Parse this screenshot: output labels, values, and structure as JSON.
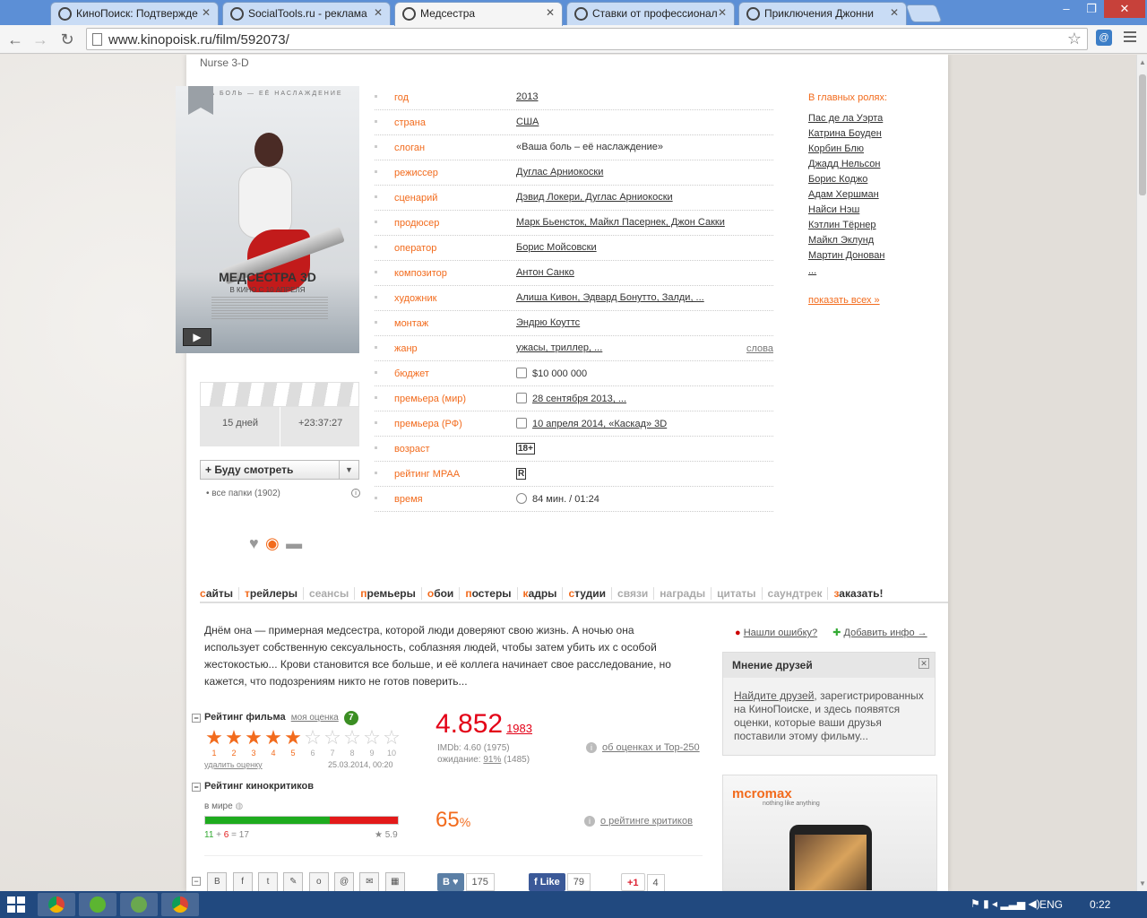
{
  "browser": {
    "tabs": [
      {
        "title": "КиноПоиск: Подтвержде",
        "active": false
      },
      {
        "title": "SocialTools.ru - реклама",
        "active": false
      },
      {
        "title": "Медсестра",
        "active": true
      },
      {
        "title": "Ставки от профессионал",
        "active": false
      },
      {
        "title": "Приключения Джонни",
        "active": false
      }
    ],
    "url": "www.kinopoisk.ru/film/592073/"
  },
  "film": {
    "original_title": "Nurse 3-D",
    "poster": {
      "slogan": "ША БОЛЬ — ЕЁ НАСЛАЖДЕНИЕ",
      "title": "МЕДСЕСТРА 3D",
      "date": "В КИНО С 10 АПРЕЛЯ"
    },
    "countdown": {
      "days": "15 дней",
      "time": "+23:37:27"
    },
    "watch_button": "+ Буду смотреть",
    "folders": "• все папки (1902)",
    "info": [
      {
        "label": "год",
        "value": "2013"
      },
      {
        "label": "страна",
        "value": "США"
      },
      {
        "label": "слоган",
        "value": "«Ваша боль – её наслаждение»"
      },
      {
        "label": "режиссер",
        "value": "Дуглас Арниокоски"
      },
      {
        "label": "сценарий",
        "value": "Дэвид Локери, Дуглас Арниокоски"
      },
      {
        "label": "продюсер",
        "value": "Марк Бьенсток, Майкл Пасернек, Джон Сакки"
      },
      {
        "label": "оператор",
        "value": "Борис Мойсовски"
      },
      {
        "label": "композитор",
        "value": "Антон Санко"
      },
      {
        "label": "художник",
        "value": "Алиша Кивон, Эдвард Бонутто, Залди, ..."
      },
      {
        "label": "монтаж",
        "value": "Эндрю Коуттс"
      },
      {
        "label": "жанр",
        "value": "ужасы, триллер, ...",
        "extra": "слова"
      },
      {
        "label": "бюджет",
        "value": "$10 000 000"
      },
      {
        "label": "премьера (мир)",
        "value": "28 сентября 2013, ..."
      },
      {
        "label": "премьера (РФ)",
        "value": "10 апреля 2014, «Каскад» 3D"
      },
      {
        "label": "возраст",
        "value": "18+"
      },
      {
        "label": "рейтинг MPAA",
        "value": "R"
      },
      {
        "label": "время",
        "value": "84 мин. / 01:24"
      }
    ],
    "cast_title": "В главных ролях:",
    "cast": [
      "Пас де ла Уэрта",
      "Катрина Боуден",
      "Корбин Блю",
      "Джадд Нельсон",
      "Борис Коджо",
      "Адам Хершман",
      "Найси Нэш",
      "Кэтлин Тёрнер",
      "Майкл Эклунд",
      "Мартин Донован",
      "..."
    ],
    "show_all": "показать всех »",
    "menu": [
      {
        "label": "сайты",
        "dim": false
      },
      {
        "label": "трейлеры",
        "dim": false
      },
      {
        "label": "сеансы",
        "dim": true
      },
      {
        "label": "премьеры",
        "dim": false
      },
      {
        "label": "обои",
        "dim": false
      },
      {
        "label": "постеры",
        "dim": false
      },
      {
        "label": "кадры",
        "dim": false
      },
      {
        "label": "студии",
        "dim": false
      },
      {
        "label": "связи",
        "dim": true
      },
      {
        "label": "награды",
        "dim": true
      },
      {
        "label": "цитаты",
        "dim": true
      },
      {
        "label": "саундтрек",
        "dim": true
      },
      {
        "label": "заказать!",
        "dim": false
      }
    ],
    "description": "Днём она — примерная медсестра, которой люди доверяют свою жизнь. А ночью она использует собственную сексуальность, соблазняя людей, чтобы затем убить их с особой жестокостью... Крови становится все больше, и её коллега начинает свое расследование, но кажется, что подозрениям никто не готов поверить...",
    "found_error": "Нашли ошибку?",
    "add_info": "Добавить инфо →",
    "friends": {
      "title": "Мнение друзей",
      "link": "Найдите друзей",
      "text": ", зарегистрированных на КиноПоиске, и здесь появятся оценки, которые ваши друзья поставили этому фильму..."
    },
    "rating": {
      "header": "Рейтинг фильма",
      "my_rating_label": "моя оценка",
      "my_rating": 7,
      "stars_filled": 5,
      "delete": "удалить оценку",
      "date": "25.03.2014, 00:20",
      "score": "4.852",
      "votes": "1983",
      "imdb": "IMDb: 4.60 (1975)",
      "expect_prefix": "ожидание: ",
      "expect_pct": "91%",
      "expect_votes": " (1485)",
      "about": "об оценках и Top-250"
    },
    "critics": {
      "header": "Рейтинг кинокритиков",
      "world": "в мире",
      "positive": 11,
      "negative": 6,
      "total": 17,
      "avg": "★ 5.9",
      "pct": "65",
      "pct_sign": "%",
      "about": "о рейтинге критиков"
    },
    "social": {
      "vk_count": "175",
      "fb_label": "Like",
      "fb_count": "79",
      "gplus_label": "+1",
      "gplus_count": "4"
    },
    "ad": {
      "brand": "cromax",
      "tagline": "nothing like anything"
    }
  },
  "taskbar": {
    "lang": "ENG",
    "time": "0:22"
  }
}
